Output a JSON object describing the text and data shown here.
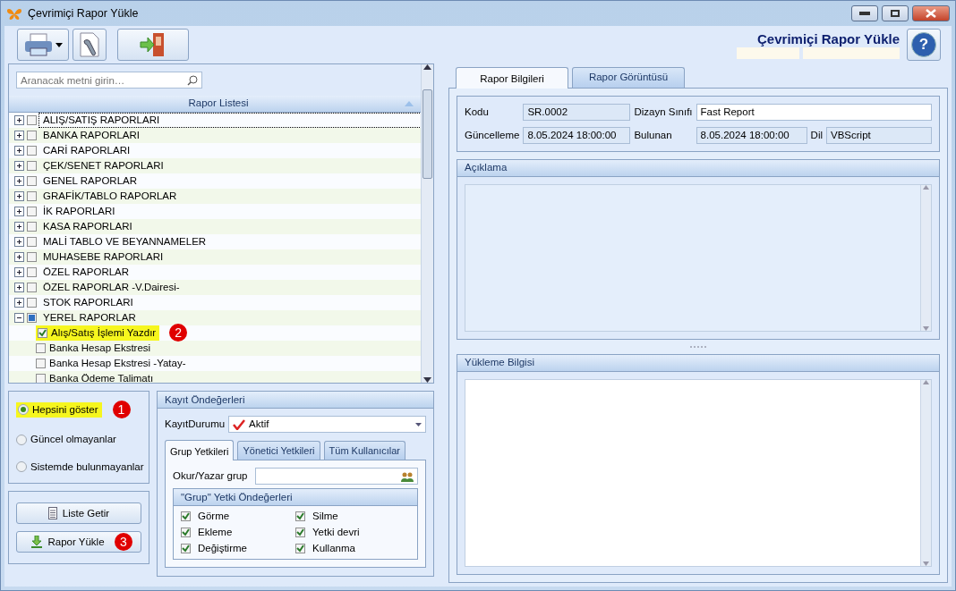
{
  "window": {
    "title": "Çevrimiçi Rapor Yükle"
  },
  "header": {
    "title": "Çevrimiçi Rapor Yükle",
    "help": "?"
  },
  "tree": {
    "search": {
      "placeholder": "Aranacak metni girin…"
    },
    "header": "Rapor Listesi",
    "items": [
      {
        "label": "ALIŞ/SATIŞ RAPORLARI",
        "expanded": false,
        "checked": false,
        "indeterminate": false,
        "focused": true
      },
      {
        "label": "BANKA RAPORLARI",
        "expanded": false,
        "checked": false,
        "indeterminate": false,
        "focused": false
      },
      {
        "label": "CARİ RAPORLARI",
        "expanded": false,
        "checked": false,
        "indeterminate": false,
        "focused": false
      },
      {
        "label": "ÇEK/SENET RAPORLARI",
        "expanded": false,
        "checked": false,
        "indeterminate": false,
        "focused": false
      },
      {
        "label": "GENEL RAPORLAR",
        "expanded": false,
        "checked": false,
        "indeterminate": false,
        "focused": false
      },
      {
        "label": "GRAFİK/TABLO RAPORLAR",
        "expanded": false,
        "checked": false,
        "indeterminate": false,
        "focused": false
      },
      {
        "label": "İK RAPORLARI",
        "expanded": false,
        "checked": false,
        "indeterminate": false,
        "focused": false
      },
      {
        "label": "KASA RAPORLARI",
        "expanded": false,
        "checked": false,
        "indeterminate": false,
        "focused": false
      },
      {
        "label": "MALİ TABLO VE BEYANNAMELER",
        "expanded": false,
        "checked": false,
        "indeterminate": false,
        "focused": false
      },
      {
        "label": "MUHASEBE RAPORLARI",
        "expanded": false,
        "checked": false,
        "indeterminate": false,
        "focused": false
      },
      {
        "label": "ÖZEL RAPORLAR",
        "expanded": false,
        "checked": false,
        "indeterminate": false,
        "focused": false
      },
      {
        "label": "ÖZEL RAPORLAR -V.Dairesi-",
        "expanded": false,
        "checked": false,
        "indeterminate": false,
        "focused": false
      },
      {
        "label": "STOK RAPORLARI",
        "expanded": false,
        "checked": false,
        "indeterminate": false,
        "focused": false
      },
      {
        "label": "YEREL RAPORLAR",
        "expanded": true,
        "checked": false,
        "indeterminate": true,
        "focused": false,
        "children": [
          {
            "label": "Alış/Satış İşlemi Yazdır",
            "checked": true,
            "highlighted": true,
            "callout": "2"
          },
          {
            "label": "Banka Hesap Ekstresi",
            "checked": false,
            "highlighted": false
          },
          {
            "label": "Banka Hesap Ekstresi -Yatay-",
            "checked": false,
            "highlighted": false
          },
          {
            "label": "Banka Ödeme Talimatı",
            "checked": false,
            "highlighted": false
          }
        ]
      }
    ]
  },
  "filters": [
    {
      "label": "Hepsini göster",
      "selected": true,
      "highlighted": true,
      "callout": "1"
    },
    {
      "label": "Güncel olmayanlar",
      "selected": false,
      "highlighted": false
    },
    {
      "label": "Sistemde bulunmayanlar",
      "selected": false,
      "highlighted": false
    }
  ],
  "actions": [
    {
      "label": "Liste Getir",
      "kind": "list"
    },
    {
      "label": "Rapor Yükle",
      "kind": "download",
      "callout": "3"
    }
  ],
  "defaults": {
    "title": "Kayıt Öndeğerleri",
    "status_label": "KayıtDurumu",
    "status_value": "Aktif",
    "tabs": [
      {
        "label": "Grup Yetkileri",
        "selected": true
      },
      {
        "label": "Yönetici Yetkileri",
        "selected": false
      },
      {
        "label": "Tüm Kullanıcılar",
        "selected": false
      }
    ],
    "group_label": "Okur/Yazar grup",
    "permissions_title": "\"Grup\" Yetki Öndeğerleri",
    "permissions": [
      {
        "label": "Görme",
        "checked": true
      },
      {
        "label": "Silme",
        "checked": true
      },
      {
        "label": "Ekleme",
        "checked": true
      },
      {
        "label": "Yetki devri",
        "checked": true
      },
      {
        "label": "Değiştirme",
        "checked": true
      },
      {
        "label": "Kullanma",
        "checked": true
      }
    ]
  },
  "details": {
    "tabs": [
      {
        "label": "Rapor Bilgileri",
        "selected": true
      },
      {
        "label": "Rapor Görüntüsü",
        "selected": false
      }
    ],
    "fields": {
      "code_label": "Kodu",
      "code": "SR.0002",
      "design_label": "Dizayn Sınıfı",
      "design": "Fast Report",
      "updated_label": "Güncelleme",
      "updated": "8.05.2024 18:00:00",
      "found_label": "Bulunan",
      "found": "8.05.2024 18:00:00",
      "language_label": "Dil",
      "language": "VBScript"
    },
    "description_title": "Açıklama",
    "upload_title": "Yükleme Bilgisi"
  }
}
